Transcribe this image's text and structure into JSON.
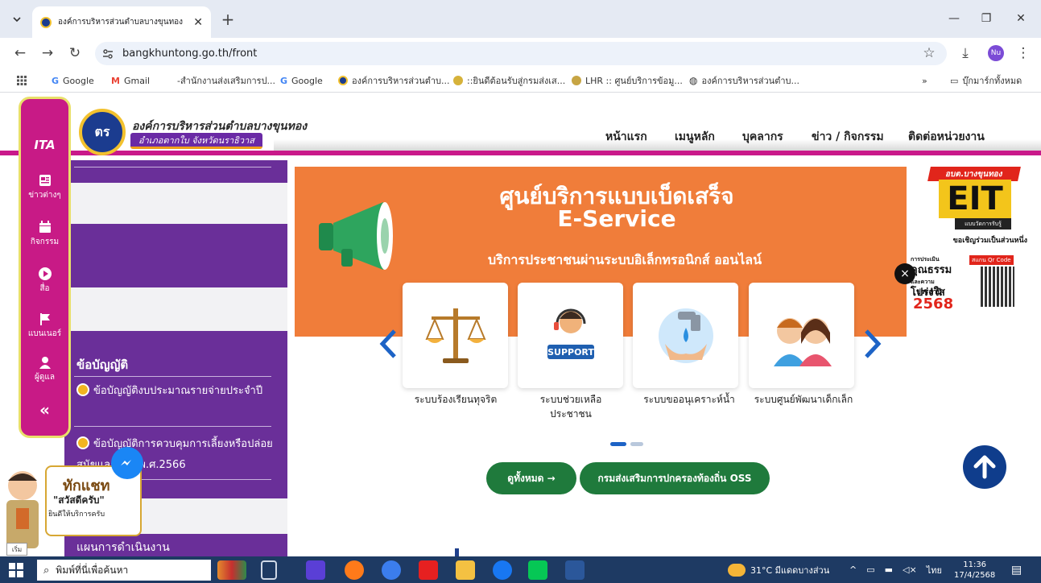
{
  "browser": {
    "tab_title": "องค์การบริหารส่วนตำบลบางขุนทอง ",
    "url": "bangkhuntong.go.th/front",
    "profile_initials": "Nu",
    "bookmarks": [
      {
        "label": "Google",
        "icon": "google-icon"
      },
      {
        "label": "Gmail",
        "icon": "gmail-icon"
      },
      {
        "label": "-สำนักงานส่งเสริมการป...",
        "icon": "none"
      },
      {
        "label": "Google",
        "icon": "google-icon"
      },
      {
        "label": "องค์การบริหารส่วนตำบ...",
        "icon": "org-seal-icon"
      },
      {
        "label": "::ยินดีต้อนรับสู่กรมส่งเส...",
        "icon": "org-seal-icon"
      },
      {
        "label": "LHR :: ศูนย์บริการข้อมู...",
        "icon": "org-seal-icon"
      },
      {
        "label": "องค์การบริหารส่วนตำบ...",
        "icon": "globe-icon"
      }
    ],
    "bookmarks_overflow": "»",
    "all_bookmarks": "บุ๊กมาร์กทั้งหมด"
  },
  "header": {
    "logo_text": "ตร",
    "org_name": "องค์การบริหารส่วนตำบลบางขุนทอง",
    "org_sub": "อำเภอตากใบ จังหวัดนราธิวาส",
    "nav": [
      "หน้าแรก",
      "เมนูหลัก",
      "บุคลากร",
      "ข่าว / กิจกรรม",
      "ติดต่อหน่วยงาน"
    ]
  },
  "ita_bar": {
    "logo": "ITA",
    "items": [
      {
        "label": "ข่าวต่างๆ",
        "icon": "news-icon"
      },
      {
        "label": "กิจกรรม",
        "icon": "calendar-icon"
      },
      {
        "label": "สื่อ",
        "icon": "play-icon"
      },
      {
        "label": "แบนเนอร์",
        "icon": "flag-icon"
      },
      {
        "label": "ผู้ดูแล",
        "icon": "user-icon"
      }
    ],
    "collapse": "«"
  },
  "sidebar": {
    "section_title": "ข้อบัญญัติ",
    "items": [
      "ข้อบัญญัติงบประมาณรายจ่ายประจำปี",
      "ข้อบัญญัติการควบคุมการเลี้ยงหรือปล่อยสุนัขและแมว พ.ศ.2566"
    ],
    "plan_title": "แผนการดำเนินงาน"
  },
  "banner": {
    "title_th": "ศูนย์บริการแบบเบ็ดเสร็จ",
    "title_en": "E-Service",
    "subtitle": "บริการประชาชนผ่านระบบอิเล็กทรอนิกส์ ออนไลน์",
    "cards": [
      {
        "label": "ระบบร้องเรียนทุจริต",
        "icon": "scales-icon"
      },
      {
        "label": "ระบบช่วยเหลือประชาชน",
        "icon": "support-agent-icon",
        "badge": "SUPPORT"
      },
      {
        "label": "ระบบขออนุเคราะห์น้ำ",
        "icon": "water-tap-icon"
      },
      {
        "label": "ระบบศูนย์พัฒนาเด็กเล็ก",
        "icon": "children-icon"
      }
    ],
    "prev": "‹",
    "next": "›"
  },
  "eit_popup": {
    "tag": "อบต.บางขุนทอง",
    "big": "EIT",
    "sub": "แบบวัดการรับรู้",
    "invite": "ขอเชิญร่วมเป็นส่วนหนึ่ง",
    "assess": "การประเมิน",
    "kun": "คุณธรรม",
    "and": "และความ",
    "transparent": "โปร่งใส",
    "qr_label": "สแกน Qr Code",
    "year_label": "ประจำปี",
    "year": "2568",
    "close": "×"
  },
  "buttons": {
    "view_all": "ดูทั้งหมด →",
    "oss": "กรมส่งเสริมการปกครองท้องถิ่น OSS"
  },
  "chat": {
    "title": "ทักแชท",
    "greeting": "\"สวัสดีครับ\"",
    "welcome": "ยินดีให้บริการครับ"
  },
  "small_label": "เริ่ม",
  "taskbar": {
    "search_placeholder": "พิมพ์ที่นี่เพื่อค้นหา",
    "weather": "31°C  มีแดดบางส่วน",
    "lang": "ไทย",
    "time": "11:36",
    "date": "17/4/2568"
  },
  "colors": {
    "magenta": "#c81a86",
    "purple": "#6a2f99",
    "orange": "#f07d3a",
    "green": "#1f7a3c",
    "navy": "#0f3d8c"
  }
}
